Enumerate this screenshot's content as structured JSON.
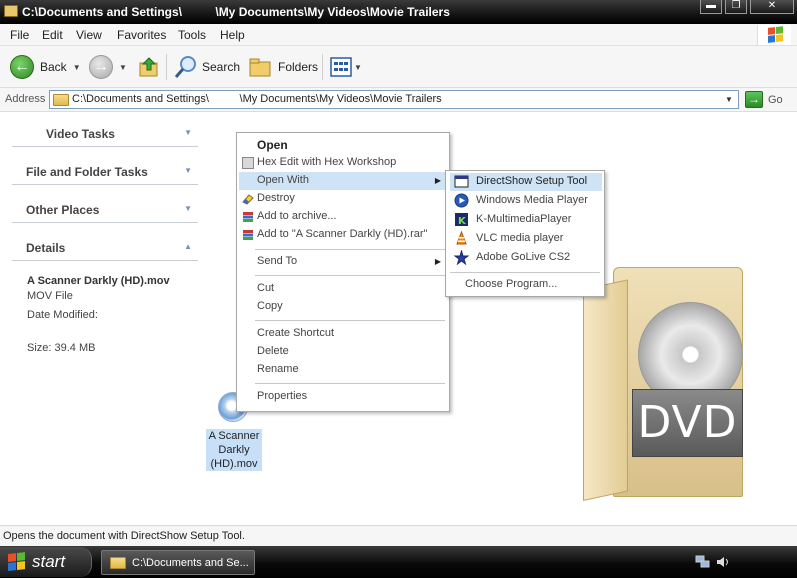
{
  "window": {
    "title": "C:\\Documents and Settings\\          \\My Documents\\My Videos\\Movie Trailers",
    "min_label": "▬",
    "max_label": "❐",
    "close_label": "✕"
  },
  "menubar": {
    "items": [
      "File",
      "Edit",
      "View",
      "Favorites",
      "Tools",
      "Help"
    ]
  },
  "toolbar": {
    "back_label": "Back",
    "search_label": "Search",
    "folders_label": "Folders"
  },
  "address": {
    "label": "Address",
    "path": "C:\\Documents and Settings\\          \\My Documents\\My Videos\\Movie Trailers",
    "go_label": "Go"
  },
  "taskpane": {
    "sections": [
      "Video Tasks",
      "File and Folder Tasks",
      "Other Places",
      "Details"
    ],
    "details": {
      "name": "A Scanner Darkly (HD).mov",
      "type": "MOV File",
      "date_label": "Date Modified:",
      "size": "Size: 39.4 MB"
    }
  },
  "file": {
    "label_line1": "A Scanner",
    "label_line2": "Darkly",
    "label_line3": "(HD).mov"
  },
  "dvd": {
    "label": "DVD"
  },
  "context_menu": {
    "open": "Open",
    "hex_edit": "Hex Edit with Hex Workshop",
    "open_with": "Open With",
    "destroy": "Destroy",
    "add_archive": "Add to archive...",
    "add_rar": "Add to \"A Scanner Darkly (HD).rar\"",
    "send_to": "Send To",
    "cut": "Cut",
    "copy": "Copy",
    "create_shortcut": "Create Shortcut",
    "delete": "Delete",
    "rename": "Rename",
    "properties": "Properties"
  },
  "submenu": {
    "items": [
      "DirectShow Setup Tool",
      "Windows Media Player",
      "K-MultimediaPlayer",
      "VLC media player",
      "Adobe GoLive CS2"
    ],
    "choose_program": "Choose Program..."
  },
  "status": {
    "text": "Opens the document with DirectShow Setup Tool."
  },
  "taskbar": {
    "start_label": "start",
    "window_label": "C:\\Documents and Se..."
  },
  "colors": {
    "selection": "#cfe3f7",
    "titlebar": "#141414",
    "taskbar": "#0a0a0a"
  }
}
